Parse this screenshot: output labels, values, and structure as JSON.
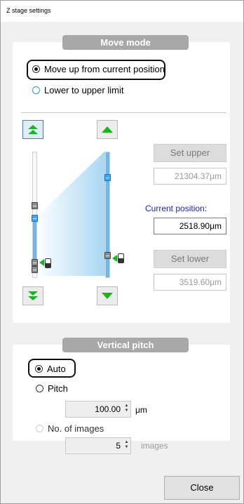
{
  "window": {
    "title": "Z stage settings"
  },
  "move_mode": {
    "header": "Move mode",
    "options": [
      {
        "label": "Move up from current position",
        "checked": true
      },
      {
        "label": "Lower to upper limit",
        "checked": false
      }
    ],
    "set_upper_label": "Set upper",
    "upper_value": "21304.37μm",
    "current_position_label": "Current position:",
    "current_position_value": "2518.90μm",
    "set_lower_label": "Set lower",
    "lower_value": "3519.60μm"
  },
  "vertical_pitch": {
    "header": "Vertical pitch",
    "auto_label": "Auto",
    "pitch_label": "Pitch",
    "pitch_value": "100.00",
    "pitch_unit": "μm",
    "images_label": "No. of images",
    "images_value": "5",
    "images_unit": "images"
  },
  "footer": {
    "close_label": "Close"
  },
  "colors": {
    "arrow_green": "#14b81e",
    "accent_blue": "#1a1ad8",
    "slider_blue": "#6fb6ea",
    "header_gray": "#a8a8a8"
  },
  "icons": [
    "move-top-icon",
    "step-up-icon",
    "move-bottom-icon",
    "step-down-icon",
    "slider-handle-icon",
    "focus-marker-icon",
    "spin-arrows-icon"
  ]
}
